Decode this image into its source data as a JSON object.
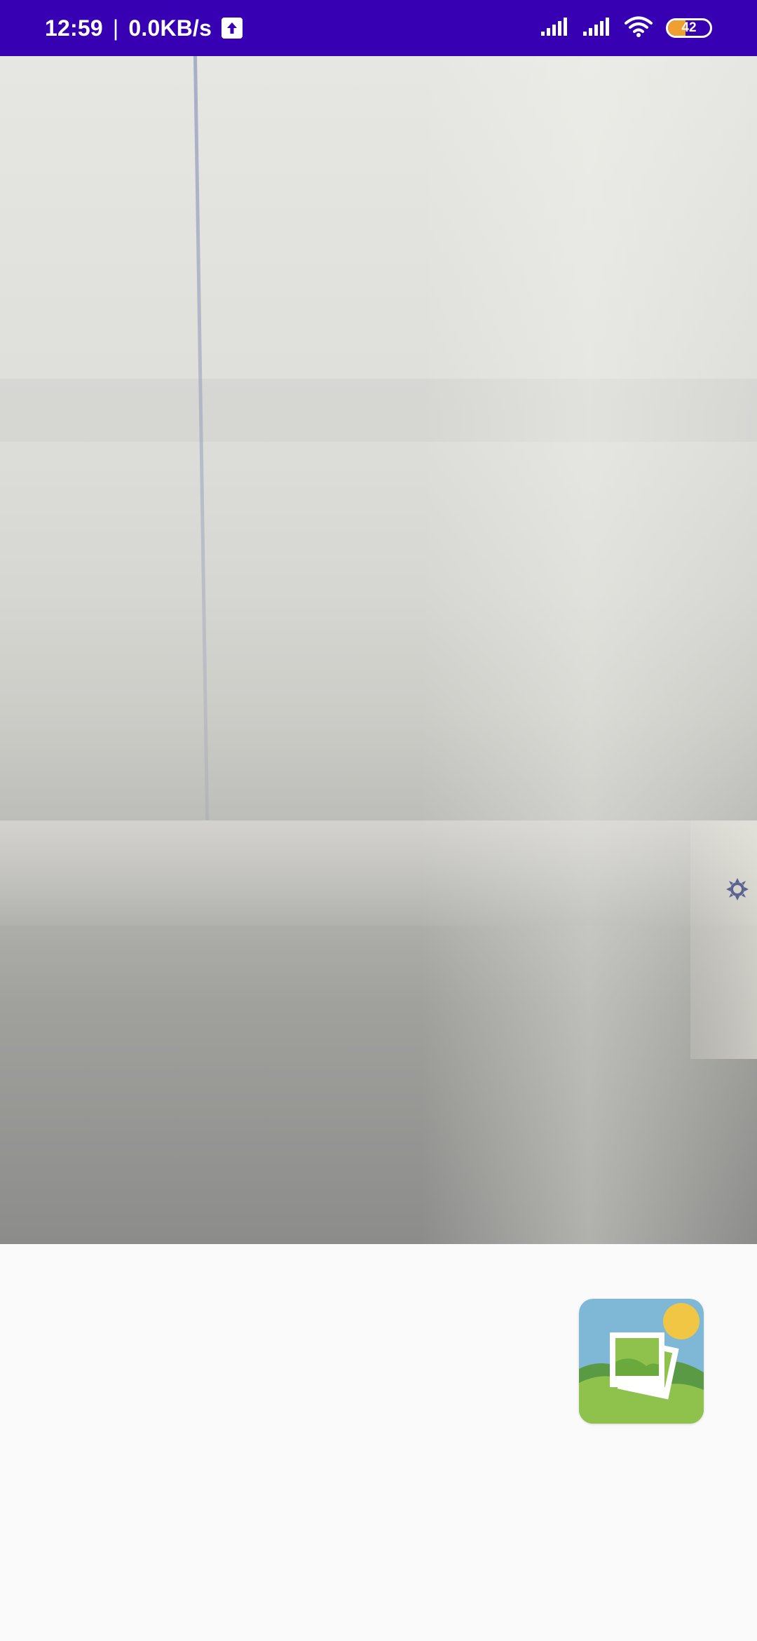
{
  "status_bar": {
    "time": "12:59",
    "network_speed": "0.0KB/s",
    "separator": "|",
    "battery_level": "42",
    "battery_fraction": 0.42,
    "icons": [
      "upload-icon",
      "signal-icon",
      "signal-icon",
      "wifi-icon",
      "battery-icon"
    ],
    "background_color": "#3700b3"
  },
  "camera_preview": {
    "overlay_icon": "gear-icon"
  },
  "bottom": {
    "gallery_icon": "gallery-icon"
  }
}
